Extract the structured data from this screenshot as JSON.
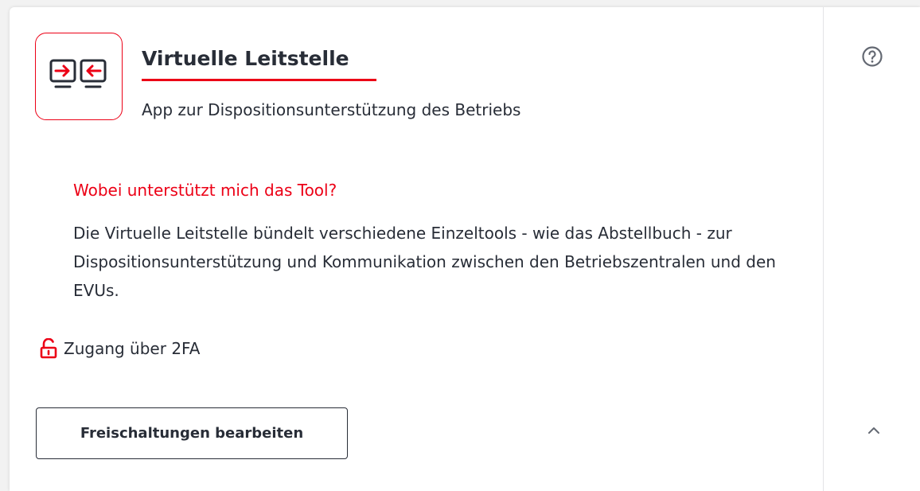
{
  "app": {
    "title": "Virtuelle Leitstelle",
    "subtitle": "App zur Dispositionsunterstützung des Betriebs",
    "icon": "monitors-exchange-icon"
  },
  "details": {
    "heading": "Wobei unterstützt mich das Tool?",
    "description": "Die Virtuelle Leitstelle bündelt verschiedene Einzeltools - wie das Abstellbuch - zur Dispositionsunterstützung und Kommunikation zwischen den Betriebszentralen und den EVUs."
  },
  "access": {
    "label": "Zugang über 2FA",
    "icon": "unlock-icon"
  },
  "actions": {
    "edit_label": "Freischaltungen bearbeiten",
    "help_icon": "help-circle-icon",
    "collapse_icon": "chevron-up-icon"
  },
  "colors": {
    "accent": "#ec0016",
    "text": "#282d37",
    "muted_icon": "#646973"
  }
}
